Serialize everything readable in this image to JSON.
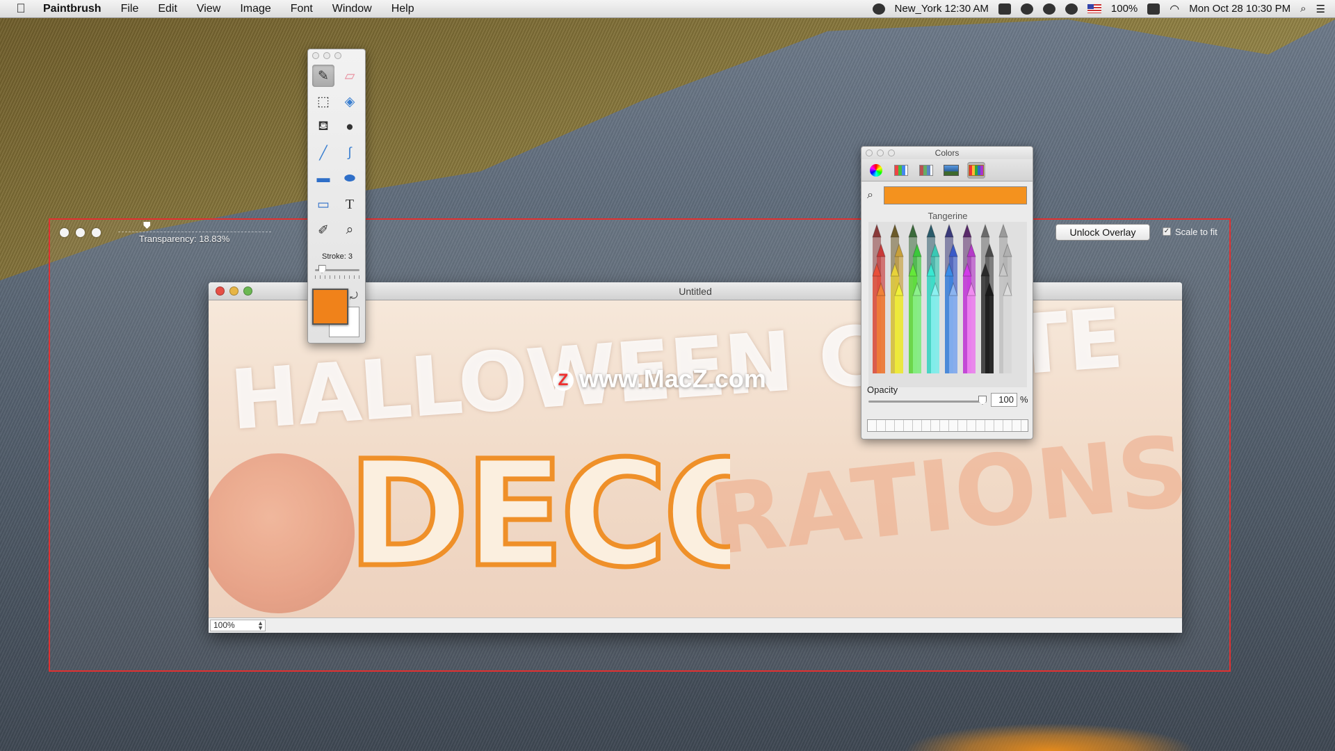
{
  "menubar": {
    "app_name": "Paintbrush",
    "menus": [
      "File",
      "Edit",
      "View",
      "Image",
      "Font",
      "Window",
      "Help"
    ],
    "clock_city": "New_York 12:30 AM",
    "battery": "100%",
    "datetime": "Mon Oct 28  10:30 PM"
  },
  "overlay": {
    "transparency_label": "Transparency: 18.83%",
    "transparency_value": 18.83,
    "unlock_label": "Unlock Overlay",
    "scale_label": "Scale to fit",
    "scale_checked": true
  },
  "document": {
    "title": "Untitled",
    "zoom": "100%",
    "watermark": "www.MacZ.com",
    "watermark_logo": "Z",
    "canvas_drawing": "DECO",
    "background_text_1": "HALLOWEEN CONTE",
    "background_text_2": "RATIONS"
  },
  "tools": {
    "items": [
      {
        "name": "brush-icon",
        "glyph": "✎",
        "selected": true
      },
      {
        "name": "eraser-icon",
        "glyph": "▱"
      },
      {
        "name": "selection-icon",
        "glyph": "⬚"
      },
      {
        "name": "fill-tag-icon",
        "glyph": "◈"
      },
      {
        "name": "paint-bucket-icon",
        "glyph": "⛾"
      },
      {
        "name": "bomb-icon",
        "glyph": "●"
      },
      {
        "name": "line-icon",
        "glyph": "╱"
      },
      {
        "name": "curve-icon",
        "glyph": "∫"
      },
      {
        "name": "rectangle-icon",
        "glyph": "▬"
      },
      {
        "name": "ellipse-icon",
        "glyph": "⬬"
      },
      {
        "name": "rounded-rect-icon",
        "glyph": "▭"
      },
      {
        "name": "text-icon",
        "glyph": "T"
      },
      {
        "name": "eyedropper-icon",
        "glyph": "✐"
      },
      {
        "name": "zoom-icon",
        "glyph": "⌕"
      }
    ],
    "stroke_label": "Stroke: 3",
    "stroke_value": 3,
    "foreground_color": "#f0821a",
    "background_color": "#ffffff"
  },
  "colors": {
    "title": "Colors",
    "tabs": [
      "color-wheel-icon",
      "color-sliders-icon",
      "color-palettes-icon",
      "image-palettes-icon",
      "crayons-icon"
    ],
    "active_tab": "crayons-icon",
    "selected_color": "#f4921e",
    "color_name": "Tangerine",
    "opacity_label": "Opacity",
    "opacity_value": "100",
    "opacity_unit": "%"
  },
  "accent": {
    "overlay_border": "#e23030",
    "deco_stroke": "#ef8a1c"
  }
}
